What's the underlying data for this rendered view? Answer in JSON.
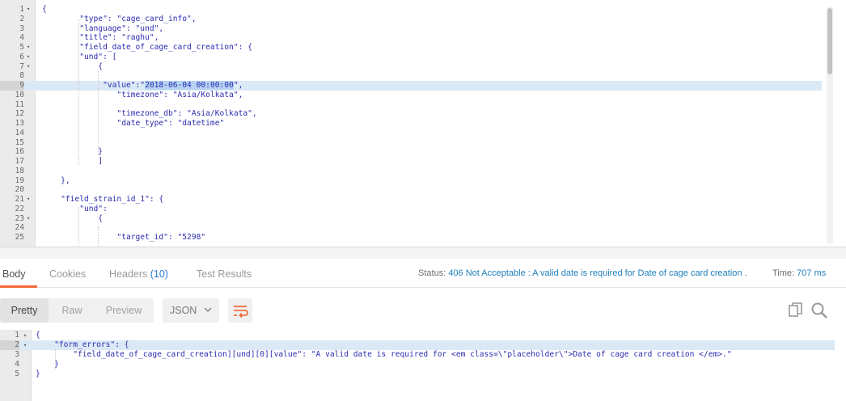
{
  "request_editor": {
    "lines": [
      {
        "n": "1",
        "fold": "▾",
        "text": "{"
      },
      {
        "n": "2",
        "fold": "",
        "text": "        \"type\": \"cage_card_info\","
      },
      {
        "n": "3",
        "fold": "",
        "text": "        \"language\": \"und\","
      },
      {
        "n": "4",
        "fold": "",
        "text": "        \"title\": \"raghu\","
      },
      {
        "n": "5",
        "fold": "▾",
        "text": "        \"field_date_of_cage_card_creation\": {"
      },
      {
        "n": "6",
        "fold": "▾",
        "text": "        \"und\": ["
      },
      {
        "n": "7",
        "fold": "▾",
        "text": "            {"
      },
      {
        "n": "8",
        "fold": "",
        "text": ""
      },
      {
        "n": "9",
        "fold": "",
        "text": "             \"value\":\"",
        "selected": "2018-06-04 00:00:00",
        "after": "\","
      },
      {
        "n": "10",
        "fold": "",
        "text": "                \"timezone\": \"Asia/Kolkata\","
      },
      {
        "n": "11",
        "fold": "",
        "text": ""
      },
      {
        "n": "12",
        "fold": "",
        "text": "                \"timezone_db\": \"Asia/Kolkata\","
      },
      {
        "n": "13",
        "fold": "",
        "text": "                \"date_type\": \"datetime\""
      },
      {
        "n": "14",
        "fold": "",
        "text": ""
      },
      {
        "n": "15",
        "fold": "",
        "text": ""
      },
      {
        "n": "16",
        "fold": "",
        "text": "            }"
      },
      {
        "n": "17",
        "fold": "",
        "text": "            ]"
      },
      {
        "n": "18",
        "fold": "",
        "text": ""
      },
      {
        "n": "19",
        "fold": "",
        "text": "    },"
      },
      {
        "n": "20",
        "fold": "",
        "text": ""
      },
      {
        "n": "21",
        "fold": "▾",
        "text": "    \"field_strain_id_1\": {"
      },
      {
        "n": "22",
        "fold": "",
        "text": "        \"und\":"
      },
      {
        "n": "23",
        "fold": "▾",
        "text": "            {"
      },
      {
        "n": "24",
        "fold": "",
        "text": ""
      },
      {
        "n": "25",
        "fold": "",
        "text": "                \"target_id\": \"5298\""
      }
    ]
  },
  "response_tabs": {
    "body": "Body",
    "cookies": "Cookies",
    "headers": "Headers",
    "headers_count": "(10)",
    "test_results": "Test Results"
  },
  "status": {
    "label": "Status:",
    "value": "406 Not Acceptable : A valid date is required for Date of cage card creation ."
  },
  "time": {
    "label": "Time:",
    "value": "707 ms"
  },
  "toolbar": {
    "pretty": "Pretty",
    "raw": "Raw",
    "preview": "Preview",
    "format": "JSON",
    "format_chevron": "chevron-down-icon",
    "wrap_icon": "wrap-lines-icon",
    "copy_icon": "copy-icon",
    "search_icon": "search-icon"
  },
  "response_body": {
    "lines": [
      {
        "n": "1",
        "fold": "▾",
        "text": "{"
      },
      {
        "n": "2",
        "fold": "▾",
        "text": "    \"form_errors\": {"
      },
      {
        "n": "3",
        "fold": "",
        "text": "        \"field_date_of_cage_card_creation][und][0][value\": \"A valid date is required for <em class=\\\"placeholder\\\">Date of cage card creation </em>.\""
      },
      {
        "n": "4",
        "fold": "",
        "text": "    }"
      },
      {
        "n": "5",
        "fold": "",
        "text": "}"
      }
    ]
  },
  "colors": {
    "accent": "#f26b3a",
    "status_value": "#1f7fbd",
    "json_text": "#2b2bb0",
    "active_line": "#dbe9f6",
    "selection": "#b5d3f3"
  }
}
